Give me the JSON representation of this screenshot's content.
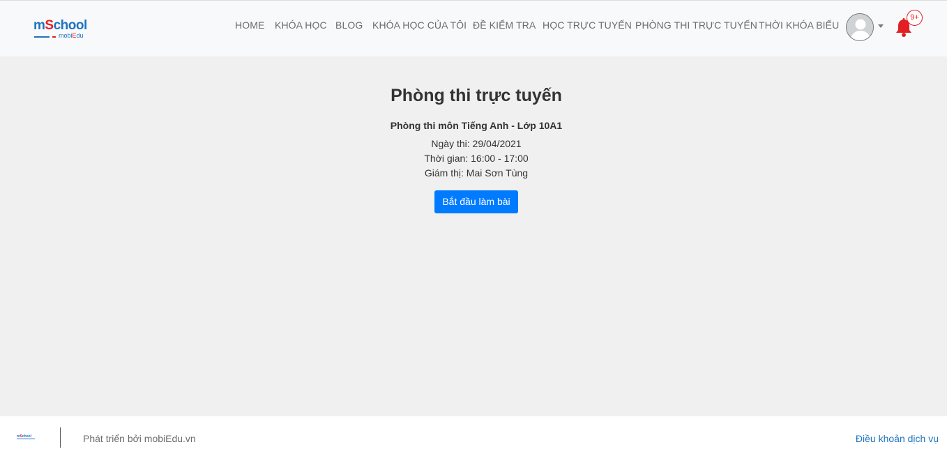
{
  "brand": {
    "logo_main_a": "m",
    "logo_main_b": "S",
    "logo_main_c": "chool",
    "logo_sub_a": "mobi",
    "logo_sub_b": "E",
    "logo_sub_c": "du",
    "color_primary": "#1e73be",
    "color_accent": "#e31f26"
  },
  "nav": {
    "items": [
      {
        "label": "HOME"
      },
      {
        "label": "KHÓA HỌC"
      },
      {
        "label": "BLOG"
      },
      {
        "label": "KHÓA HỌC CỦA TÔI"
      },
      {
        "label": "ĐỀ KIỂM TRA"
      },
      {
        "label": "HỌC TRỰC TUYẾN"
      },
      {
        "label": "PHÒNG THI TRỰC TUYẾN"
      },
      {
        "label": "THỜI KHÓA BIỂU"
      }
    ],
    "notifications_badge": "9+",
    "avatar_icon": "user-avatar-icon",
    "bell_icon": "bell-icon"
  },
  "main": {
    "title": "Phòng thi trực tuyến",
    "exam_name": "Phòng thi môn Tiếng Anh - Lớp 10A1",
    "date": "Ngày thi: 29/04/2021",
    "time": "Thời gian: 16:00 - 17:00",
    "proctor": "Giám thị: Mai Sơn Tùng",
    "start_label": "Bắt đầu làm bài",
    "button_color": "#007bff"
  },
  "footer": {
    "developed_by": "Phát triển bởi mobiEdu.vn",
    "terms": "Điều khoản dịch vụ"
  }
}
